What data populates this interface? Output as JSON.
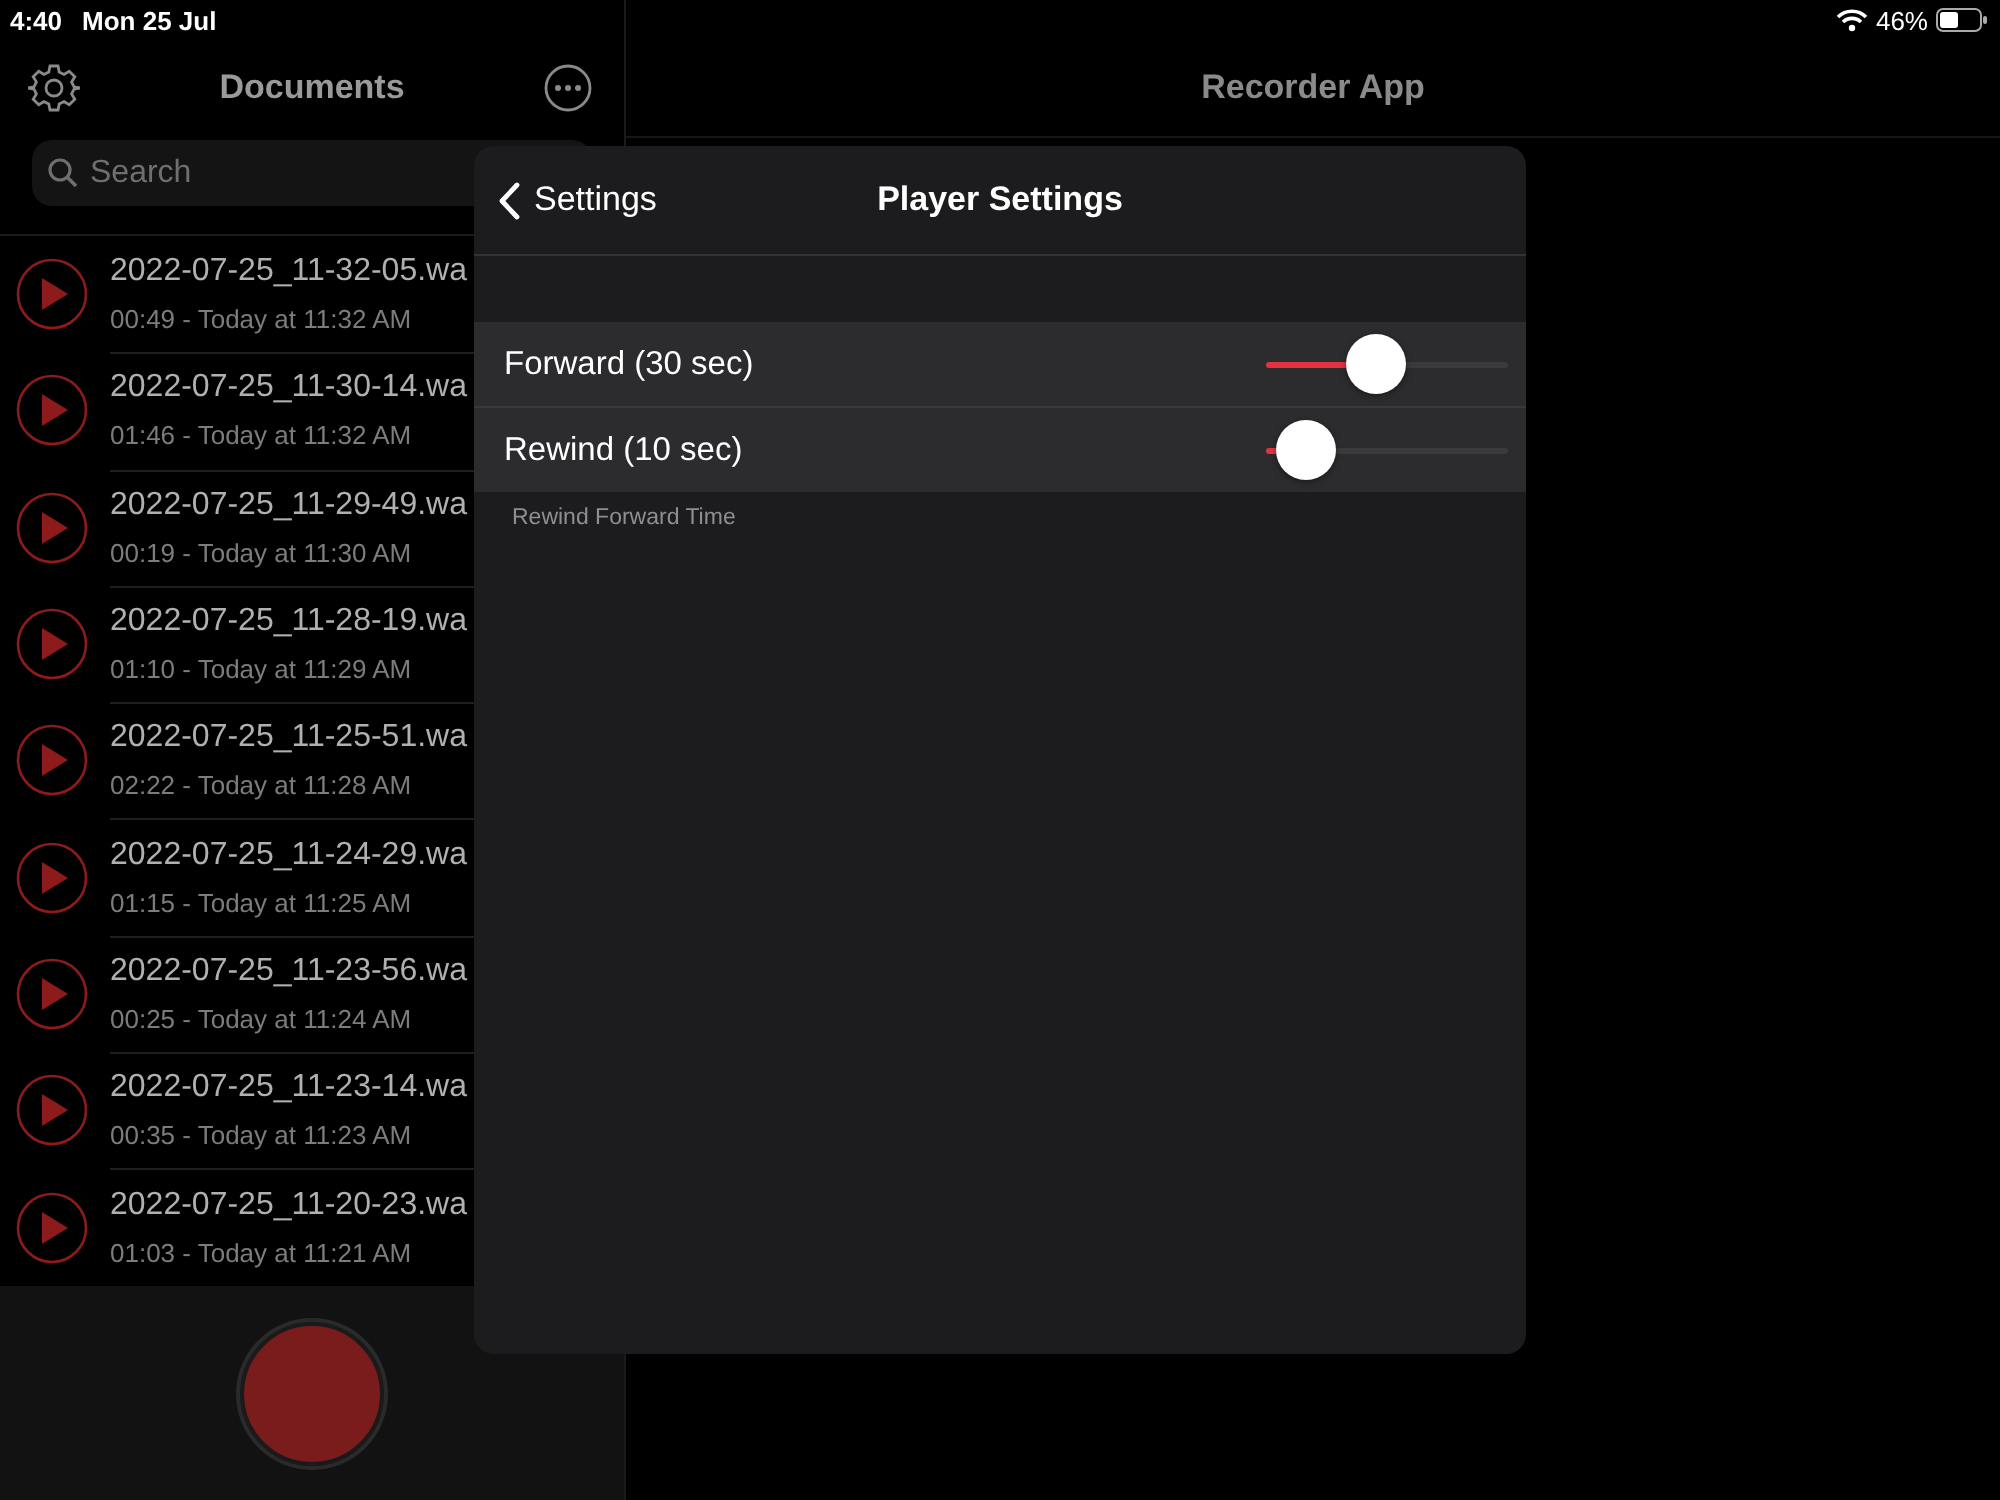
{
  "status_bar": {
    "time": "4:40",
    "date": "Mon 25 Jul",
    "battery": "46%"
  },
  "sidebar": {
    "title": "Documents",
    "search": {
      "placeholder": "Search"
    },
    "recordings": [
      {
        "name": "2022-07-25_11-32-05.wa",
        "details": "00:49 - Today at 11:32 AM"
      },
      {
        "name": "2022-07-25_11-30-14.wa",
        "details": "01:46 - Today at 11:32 AM"
      },
      {
        "name": "2022-07-25_11-29-49.wa",
        "details": "00:19 - Today at 11:30 AM"
      },
      {
        "name": "2022-07-25_11-28-19.wa",
        "details": "01:10 - Today at 11:29 AM"
      },
      {
        "name": "2022-07-25_11-25-51.wa",
        "details": "02:22 - Today at 11:28 AM"
      },
      {
        "name": "2022-07-25_11-24-29.wa",
        "details": "01:15 - Today at 11:25 AM"
      },
      {
        "name": "2022-07-25_11-23-56.wa",
        "details": "00:25 - Today at 11:24 AM"
      },
      {
        "name": "2022-07-25_11-23-14.wa",
        "details": "00:35 - Today at 11:23 AM"
      },
      {
        "name": "2022-07-25_11-20-23.wa",
        "details": "01:03 - Today at 11:21 AM"
      }
    ]
  },
  "detail": {
    "title": "Recorder App"
  },
  "player_settings": {
    "back": "Settings",
    "title": "Player Settings",
    "rows": [
      {
        "label": "Forward (30 sec)",
        "level": 0.44
      },
      {
        "label": "Rewind (10 sec)",
        "level": 0.05
      }
    ],
    "footer": "Rewind Forward Time"
  }
}
